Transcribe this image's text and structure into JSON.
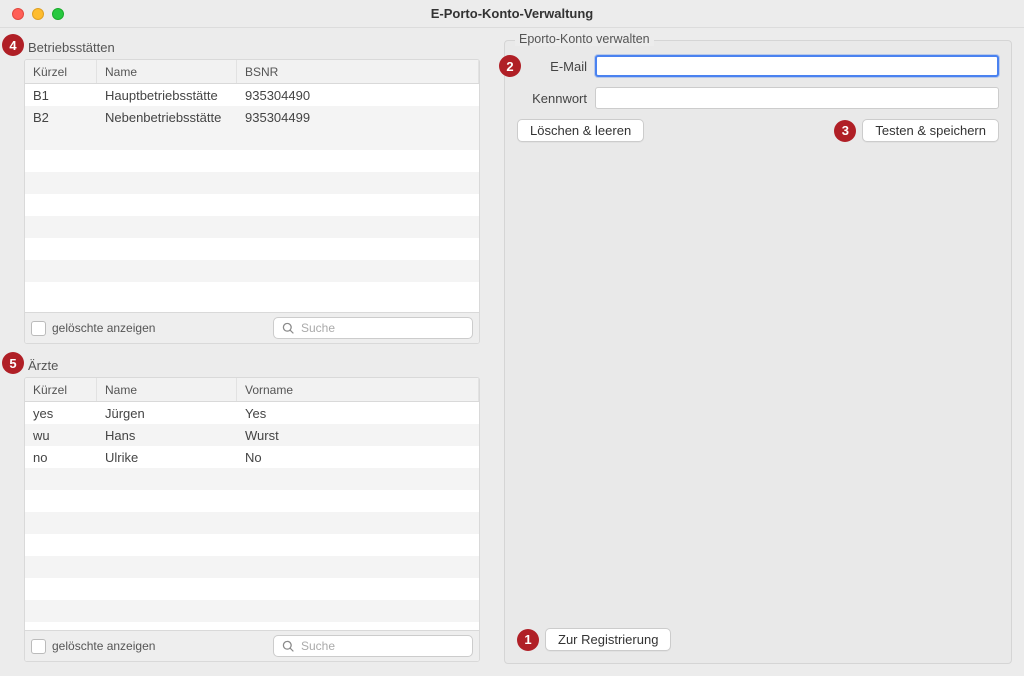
{
  "window": {
    "title": "E-Porto-Konto-Verwaltung"
  },
  "badges": {
    "b1": "1",
    "b2": "2",
    "b3": "3",
    "b4": "4",
    "b5": "5"
  },
  "panels": {
    "betriebsstaetten": {
      "label": "Betriebsstätten",
      "headers": [
        "Kürzel",
        "Name",
        "BSNR"
      ],
      "rows": [
        {
          "a": "B1",
          "b": "Hauptbetriebsstätte",
          "c": "935304490"
        },
        {
          "a": "B2",
          "b": "Nebenbetriebsstätte",
          "c": "935304499"
        }
      ],
      "show_deleted_label": "gelöschte anzeigen",
      "search_placeholder": "Suche"
    },
    "aerzte": {
      "label": "Ärzte",
      "headers": [
        "Kürzel",
        "Name",
        "Vorname"
      ],
      "rows": [
        {
          "a": "yes",
          "b": "Jürgen",
          "c": "Yes"
        },
        {
          "a": "wu",
          "b": "Hans",
          "c": "Wurst"
        },
        {
          "a": "no",
          "b": "Ulrike",
          "c": "No"
        }
      ],
      "show_deleted_label": "gelöschte anzeigen",
      "search_placeholder": "Suche"
    }
  },
  "account": {
    "group_title": "Eporto-Konto verwalten",
    "email_label": "E-Mail",
    "email_value": "",
    "password_label": "Kennwort",
    "password_value": "",
    "delete_btn": "Löschen & leeren",
    "test_btn": "Testen & speichern",
    "register_btn": "Zur Registrierung"
  }
}
